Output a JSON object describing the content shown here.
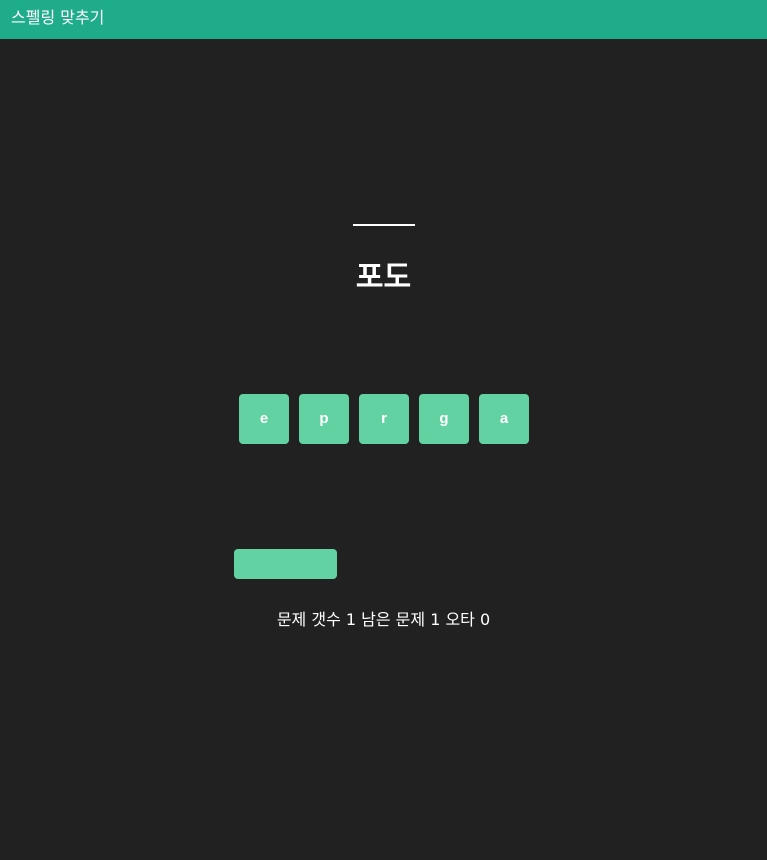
{
  "app": {
    "title": "스펠링 맞추기"
  },
  "quiz": {
    "answer": "",
    "word": "포도",
    "tiles": [
      "e",
      "p",
      "r",
      "g",
      "a"
    ],
    "check_button_label": ""
  },
  "status": {
    "text": "문제 갯수 1 남은 문제 1 오타 0",
    "total_questions": 1,
    "remaining_questions": 1,
    "typos": 0
  },
  "colors": {
    "header": "#1eac8b",
    "background": "#212121",
    "accent": "#62d2a2",
    "text": "#ffffff"
  }
}
